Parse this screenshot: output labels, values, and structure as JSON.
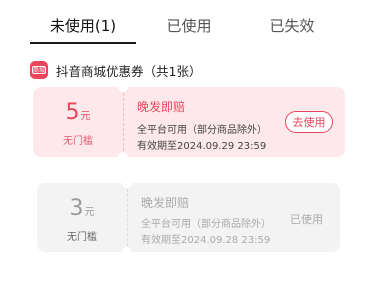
{
  "tabs": [
    {
      "label": "未使用(1)"
    },
    {
      "label": "已使用"
    },
    {
      "label": "已失效"
    }
  ],
  "section": {
    "title": "抖音商城优惠券（共1张）",
    "logo_text": "商城"
  },
  "coupons": [
    {
      "amount": "5",
      "unit": "元",
      "threshold": "无门槛",
      "title": "晚发即赔",
      "scope": "全平台可用（部分商品除外）",
      "validity": "有效期至2024.09.29 23:59",
      "action": "去使用"
    },
    {
      "amount": "3",
      "unit": "元",
      "threshold": "无门槛",
      "title": "晚发即赔",
      "scope": "全平台可用（部分商品除外）",
      "validity": "有效期至2024.09.28 23:59",
      "status": "已使用"
    }
  ],
  "colors": {
    "accent": "#e9455b",
    "active_bg": "#fde9ec",
    "used_bg": "#f3f3f3"
  }
}
